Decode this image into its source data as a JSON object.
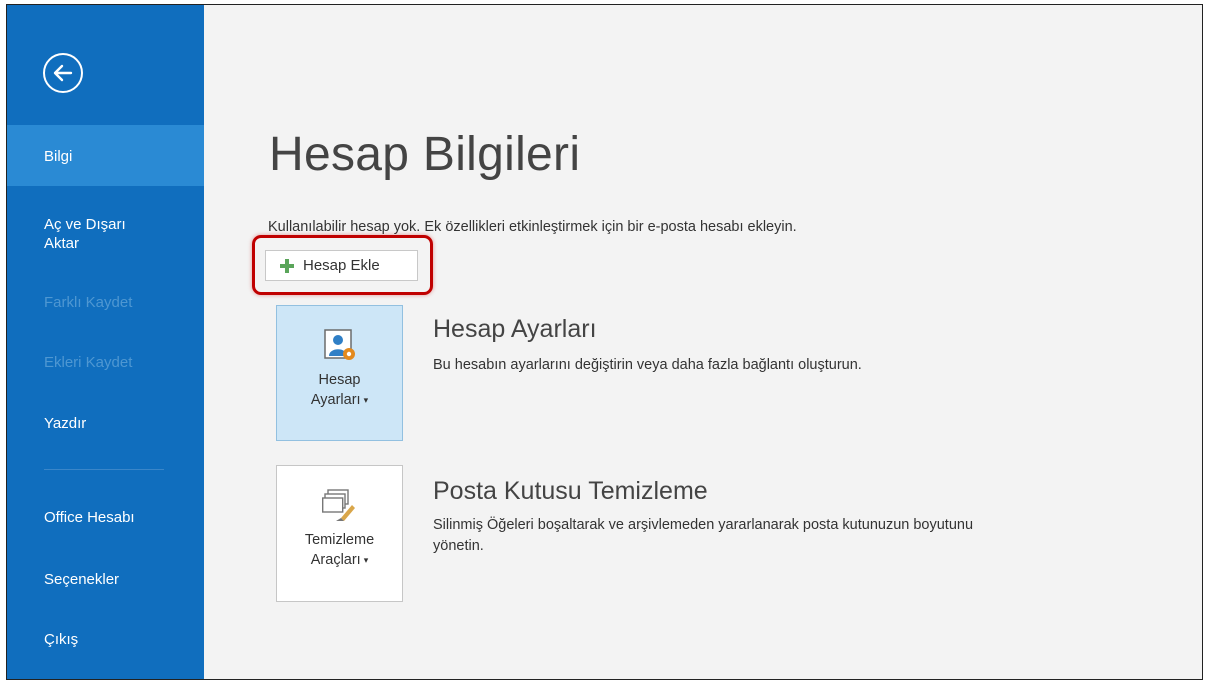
{
  "sidebar": {
    "back_icon": "arrow-left-circle-icon",
    "items": [
      {
        "label": "Bilgi",
        "state": "active"
      },
      {
        "label": "Aç ve Dışarı Aktar",
        "state": "normal"
      },
      {
        "label": "Farklı Kaydet",
        "state": "disabled"
      },
      {
        "label": "Ekleri Kaydet",
        "state": "disabled"
      },
      {
        "label": "Yazdır",
        "state": "normal"
      },
      {
        "label": "Office Hesabı",
        "state": "normal"
      },
      {
        "label": "Seçenekler",
        "state": "normal"
      },
      {
        "label": "Çıkış",
        "state": "normal"
      }
    ],
    "nav_item_labels": {
      "open_line1": "Aç ve Dışarı",
      "open_line2": "Aktar"
    }
  },
  "main": {
    "title": "Hesap Bilgileri",
    "info_text": "Kullanılabilir hesap yok. Ek özellikleri etkinleştirmek için bir e-posta hesabı ekleyin.",
    "add_account_button": {
      "label": "Hesap Ekle",
      "icon": "plus-icon"
    },
    "sections": [
      {
        "tile_label_line1": "Hesap",
        "tile_label_line2": "Ayarları",
        "icon": "account-settings-icon",
        "title": "Hesap Ayarları",
        "description": "Bu hesabın ayarlarını değiştirin veya daha fazla bağlantı oluşturun."
      },
      {
        "tile_label_line1": "Temizleme",
        "tile_label_line2": "Araçları",
        "icon": "cleanup-tools-icon",
        "title": "Posta Kutusu Temizleme",
        "description_line1": "Silinmiş Öğeleri boşaltarak ve arşivlemeden yararlanarak posta kutunuzun boyutunu",
        "description_line2": "yönetin."
      }
    ]
  },
  "colors": {
    "sidebar_bg": "#106ebe",
    "sidebar_active": "#2a8ad4",
    "sidebar_disabled_text": "#4e97d2",
    "highlight_border": "#c00000",
    "selected_tile_bg": "#cde6f7"
  }
}
